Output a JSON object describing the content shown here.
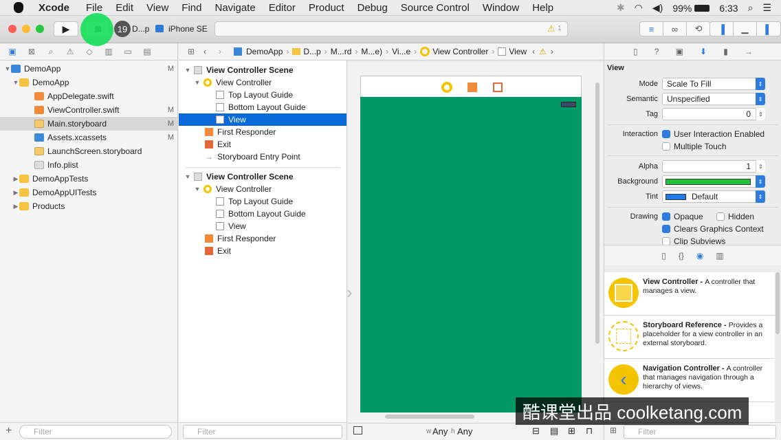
{
  "menubar": {
    "app": "Xcode",
    "items": [
      "File",
      "Edit",
      "View",
      "Find",
      "Navigate",
      "Editor",
      "Product",
      "Debug",
      "Source Control",
      "Window",
      "Help"
    ],
    "battery": "99%",
    "time": "6:33"
  },
  "toolbar": {
    "task_count": "19",
    "scheme": "D...p",
    "device": "iPhone SE",
    "warnings": "1"
  },
  "navigator": {
    "items": [
      {
        "label": "DemoApp",
        "badge": "M"
      },
      {
        "label": "DemoApp",
        "badge": ""
      },
      {
        "label": "AppDelegate.swift",
        "badge": ""
      },
      {
        "label": "ViewController.swift",
        "badge": "M"
      },
      {
        "label": "Main.storyboard",
        "badge": "M"
      },
      {
        "label": "Assets.xcassets",
        "badge": "M"
      },
      {
        "label": "LaunchScreen.storyboard",
        "badge": ""
      },
      {
        "label": "Info.plist",
        "badge": ""
      },
      {
        "label": "DemoAppTests",
        "badge": ""
      },
      {
        "label": "DemoAppUITests",
        "badge": ""
      },
      {
        "label": "Products",
        "badge": ""
      }
    ],
    "filter_placeholder": "Filter"
  },
  "jumpbar": {
    "crumbs": [
      "DemoApp",
      "D...p",
      "M...rd",
      "M...e)",
      "Vi...e",
      "View Controller",
      "View"
    ]
  },
  "outline": {
    "scene1": {
      "title": "View Controller Scene",
      "items": [
        "View Controller",
        "Top Layout Guide",
        "Bottom Layout Guide",
        "View",
        "First Responder",
        "Exit",
        "Storyboard Entry Point"
      ]
    },
    "scene2": {
      "title": "View Controller Scene",
      "items": [
        "View Controller",
        "Top Layout Guide",
        "Bottom Layout Guide",
        "View",
        "First Responder",
        "Exit"
      ]
    },
    "filter_placeholder": "Filter"
  },
  "canvas": {
    "size_class_w": "Any",
    "size_class_h": "Any",
    "w_label": "w",
    "h_label": "h",
    "view_color": "#009966"
  },
  "inspector": {
    "section": "View",
    "mode_label": "Mode",
    "mode_value": "Scale To Fill",
    "semantic_label": "Semantic",
    "semantic_value": "Unspecified",
    "tag_label": "Tag",
    "tag_value": "0",
    "interaction_label": "Interaction",
    "user_interaction": "User Interaction Enabled",
    "multiple_touch": "Multiple Touch",
    "alpha_label": "Alpha",
    "alpha_value": "1",
    "background_label": "Background",
    "background_color": "#22c23a",
    "tint_label": "Tint",
    "tint_value": "Default",
    "drawing_label": "Drawing",
    "opaque": "Opaque",
    "hidden": "Hidden",
    "clears": "Clears Graphics Context",
    "clip": "Clip Subviews"
  },
  "library": [
    {
      "title": "View Controller",
      "sep": " - ",
      "desc": "A controller that manages a view."
    },
    {
      "title": "Storyboard Reference",
      "sep": " - ",
      "desc": "Provides a placeholder for a view controller in an external storyboard."
    },
    {
      "title": "Navigation Controller",
      "sep": " - ",
      "desc": "A controller that manages navigation through a hierarchy of views."
    }
  ],
  "library_filter_placeholder": "Filter",
  "watermark": "酷课堂出品 coolketang.com"
}
